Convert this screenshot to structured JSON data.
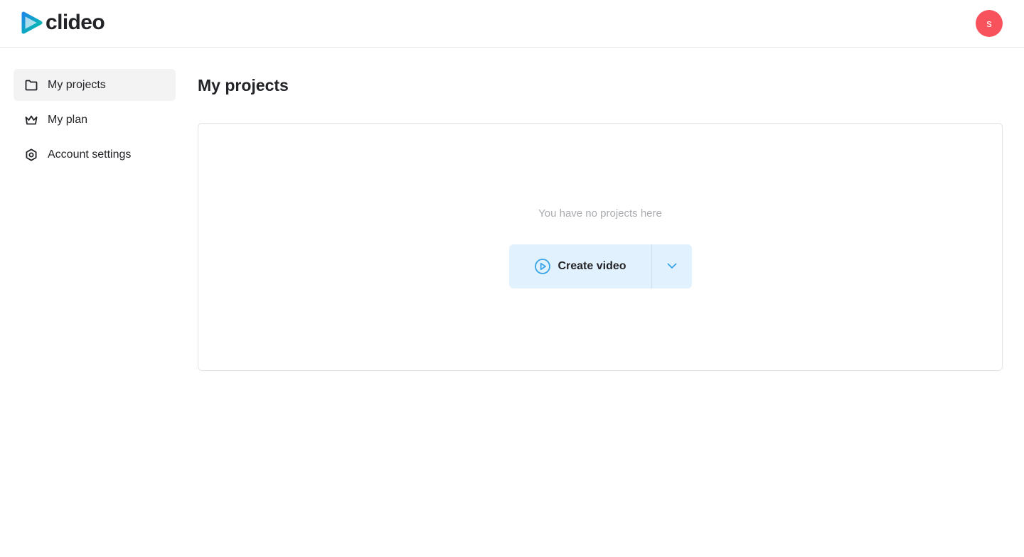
{
  "header": {
    "brand": "clideo",
    "avatar_initial": "s",
    "avatar_color": "#f8535d"
  },
  "sidebar": {
    "items": [
      {
        "label": "My projects",
        "icon": "folder-icon",
        "active": true
      },
      {
        "label": "My plan",
        "icon": "crown-icon",
        "active": false
      },
      {
        "label": "Account settings",
        "icon": "settings-icon",
        "active": false
      }
    ]
  },
  "main": {
    "title": "My projects",
    "empty_message": "You have no projects here",
    "create_button_label": "Create video",
    "create_button_icon": "play-circle-icon",
    "dropdown_icon": "chevron-down-icon",
    "accent_color": "#3aa5e8",
    "button_bg": "#e1f1fd"
  }
}
